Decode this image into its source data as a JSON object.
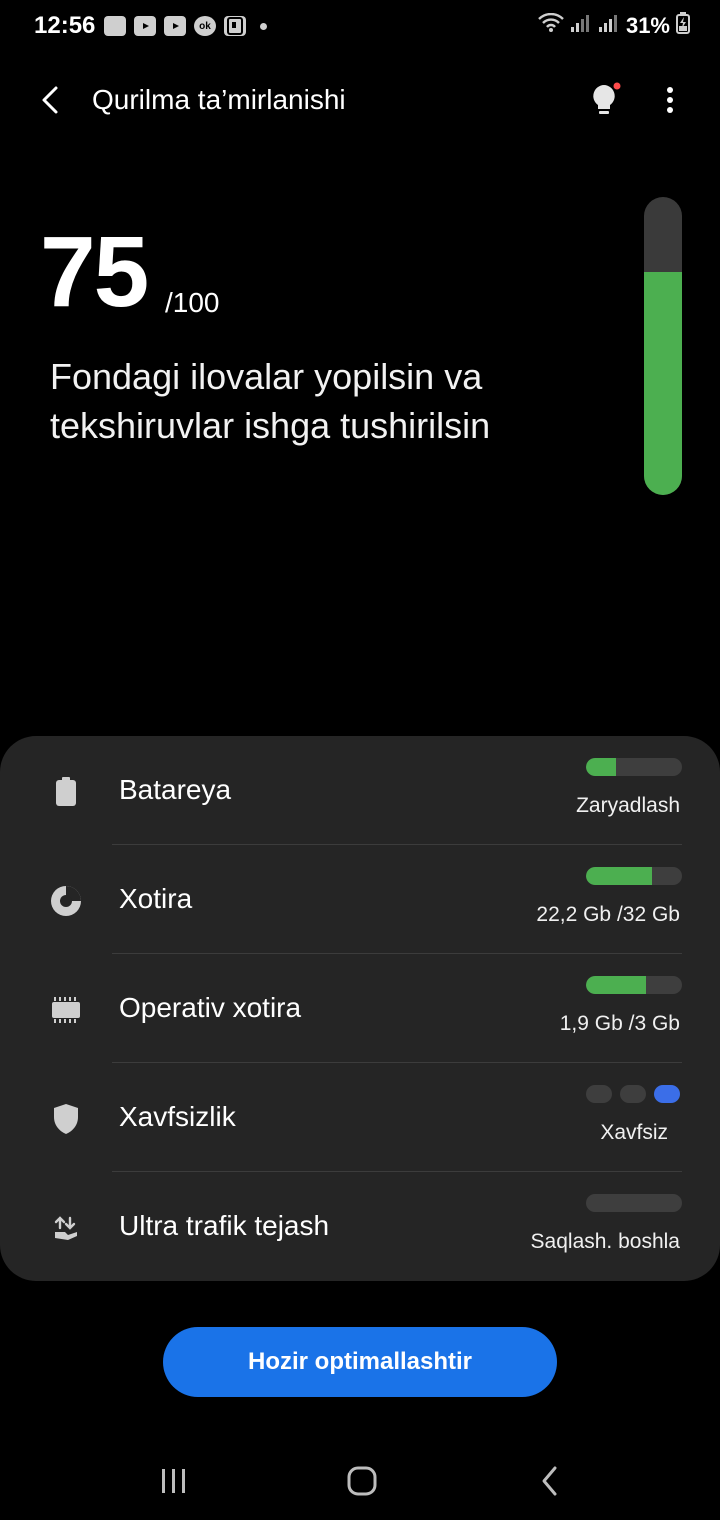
{
  "status_bar": {
    "time": "12:56",
    "notification_icons": [
      "chat-bubble-icon",
      "youtube-icon",
      "youtube-icon",
      "ok-icon",
      "clipboard-icon"
    ],
    "battery_percent": "31%"
  },
  "app_bar": {
    "title": "Qurilma ta’mirlanishi"
  },
  "score": {
    "value": "75",
    "max": "/100",
    "fill_fraction": 0.75,
    "message": "Fondagi ilovalar yopilsin va tekshiruvlar ishga tushirilsin"
  },
  "items": [
    {
      "label": "Batareya",
      "value": "Zaryadlash",
      "icon": "battery-icon",
      "fill_fraction": 0.31
    },
    {
      "label": "Xotira",
      "value": "22,2 Gb /32 Gb",
      "icon": "pie-chart-icon",
      "fill_fraction": 0.69
    },
    {
      "label": "Operativ xotira",
      "value": "1,9 Gb /3 Gb",
      "icon": "memory-chip-icon",
      "fill_fraction": 0.63
    },
    {
      "label": "Xavfsizlik",
      "value": "Xavfsiz",
      "icon": "shield-icon",
      "level": "3/3"
    },
    {
      "label": "Ultra trafik tejash",
      "value": "Saqlash. boshla",
      "icon": "data-saver-icon",
      "fill_fraction": 0
    }
  ],
  "cta": {
    "label": "Hozir optimallashtir"
  },
  "colors": {
    "good": "#4caf50",
    "accent": "#1a73e8",
    "secure": "#3b6ee8"
  }
}
